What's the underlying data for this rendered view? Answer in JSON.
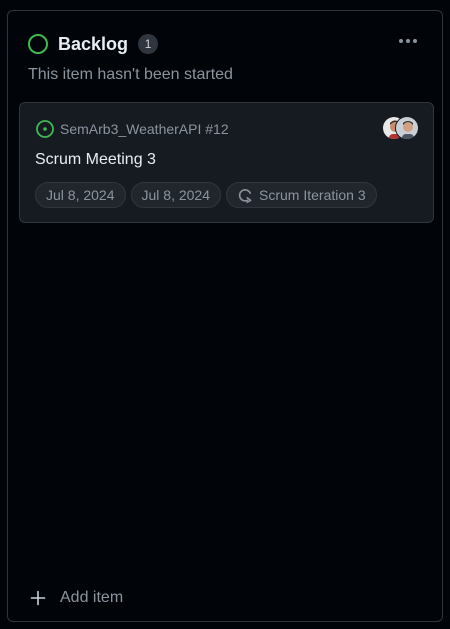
{
  "column": {
    "title": "Backlog",
    "count": "1",
    "description": "This item hasn't been started",
    "status_color": "#3fb950",
    "menu_icon": "kebab-horizontal-icon"
  },
  "card": {
    "repo_ref": "SemArb3_WeatherAPI #12",
    "title": "Scrum Meeting 3",
    "issue_icon": "issue-opened-icon",
    "tokens": [
      {
        "label": "Jul 8, 2024"
      },
      {
        "label": "Jul 8, 2024"
      },
      {
        "label": "Scrum Iteration 3",
        "icon": "iteration-icon"
      }
    ],
    "assignees": [
      "avatar-1",
      "avatar-2"
    ]
  },
  "footer": {
    "add_label": "Add item",
    "icon": "plus-icon"
  }
}
